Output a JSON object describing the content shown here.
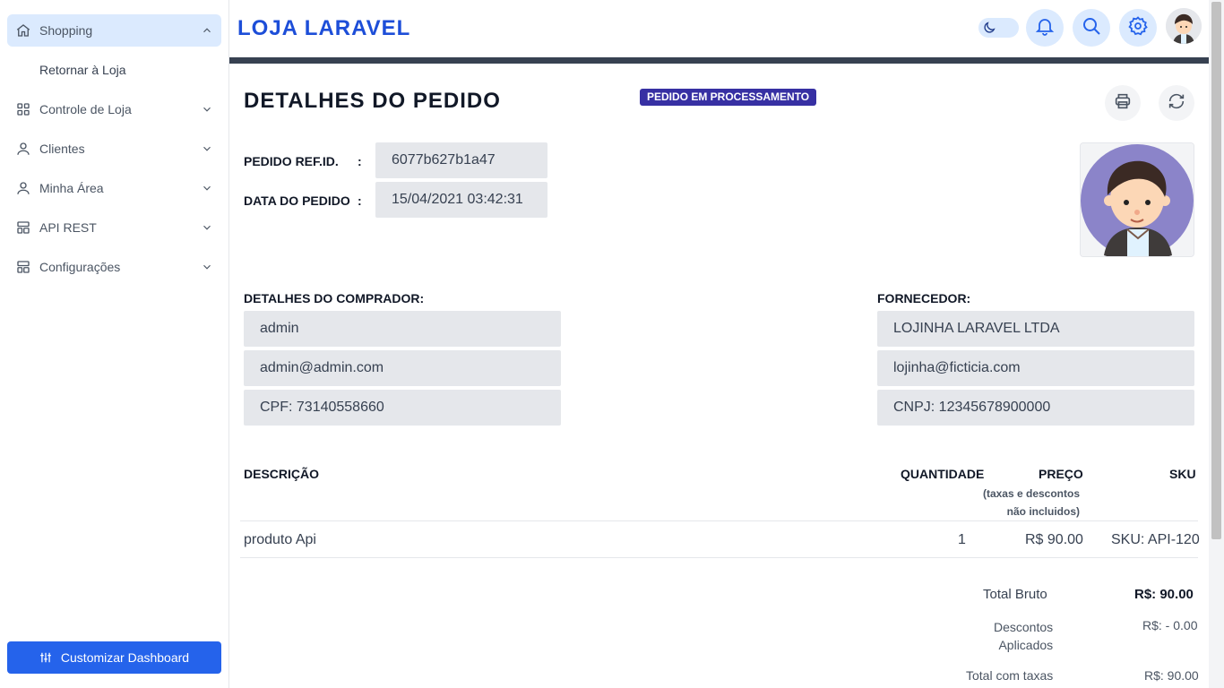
{
  "sidebar": {
    "items": [
      {
        "label": "Shopping",
        "icon": "home-icon",
        "expanded": true
      },
      {
        "label": "Controle de Loja",
        "icon": "grid-icon"
      },
      {
        "label": "Clientes",
        "icon": "user-icon"
      },
      {
        "label": "Minha Área",
        "icon": "user-icon"
      },
      {
        "label": "API REST",
        "icon": "layout-icon"
      },
      {
        "label": "Configurações",
        "icon": "layout-icon"
      }
    ],
    "sub_item": "Retornar à Loja",
    "customize_button": "Customizar Dashboard"
  },
  "header": {
    "brand": "LOJA LARAVEL"
  },
  "order": {
    "title": "DETALHES DO PEDIDO",
    "status_badge": "PEDIDO EM PROCESSAMENTO",
    "ref_label": "PEDIDO REF.ID.",
    "ref_value": "6077b627b1a47",
    "date_label": "DATA DO PEDIDO",
    "date_value": "15/04/2021  03:42:31",
    "colon": ":"
  },
  "buyer": {
    "label": "DETALHES DO COMPRADOR:",
    "name": "admin",
    "email": "admin@admin.com",
    "doc": "CPF: 73140558660"
  },
  "supplier": {
    "label": "FORNECEDOR:",
    "name": "LOJINHA LARAVEL LTDA",
    "email": "lojinha@ficticia.com",
    "doc": "CNPJ: 12345678900000"
  },
  "table": {
    "headers": {
      "description": "DESCRIÇÃO",
      "quantity": "QUANTIDADE",
      "price": "PREÇO",
      "price_note_1": "(taxas e descontos",
      "price_note_2": "não incluidos)",
      "sku": "SKU"
    },
    "rows": [
      {
        "description": "produto Api",
        "quantity": "1",
        "price": "R$ 90.00",
        "sku": "SKU: API-120"
      }
    ]
  },
  "totals": {
    "gross_label": "Total Bruto",
    "gross_value": "R$: 90.00",
    "discount_label_1": "Descontos",
    "discount_label_2": "Aplicados",
    "discount_value": "R$: - 0.00",
    "with_tax_label": "Total com taxas",
    "with_tax_value": "R$: 90.00"
  },
  "colors": {
    "primary": "#2563eb",
    "brand": "#1d4ed8",
    "badge": "#3730a3",
    "active_nav": "#dbeafe",
    "field_bg": "#e5e7eb"
  }
}
